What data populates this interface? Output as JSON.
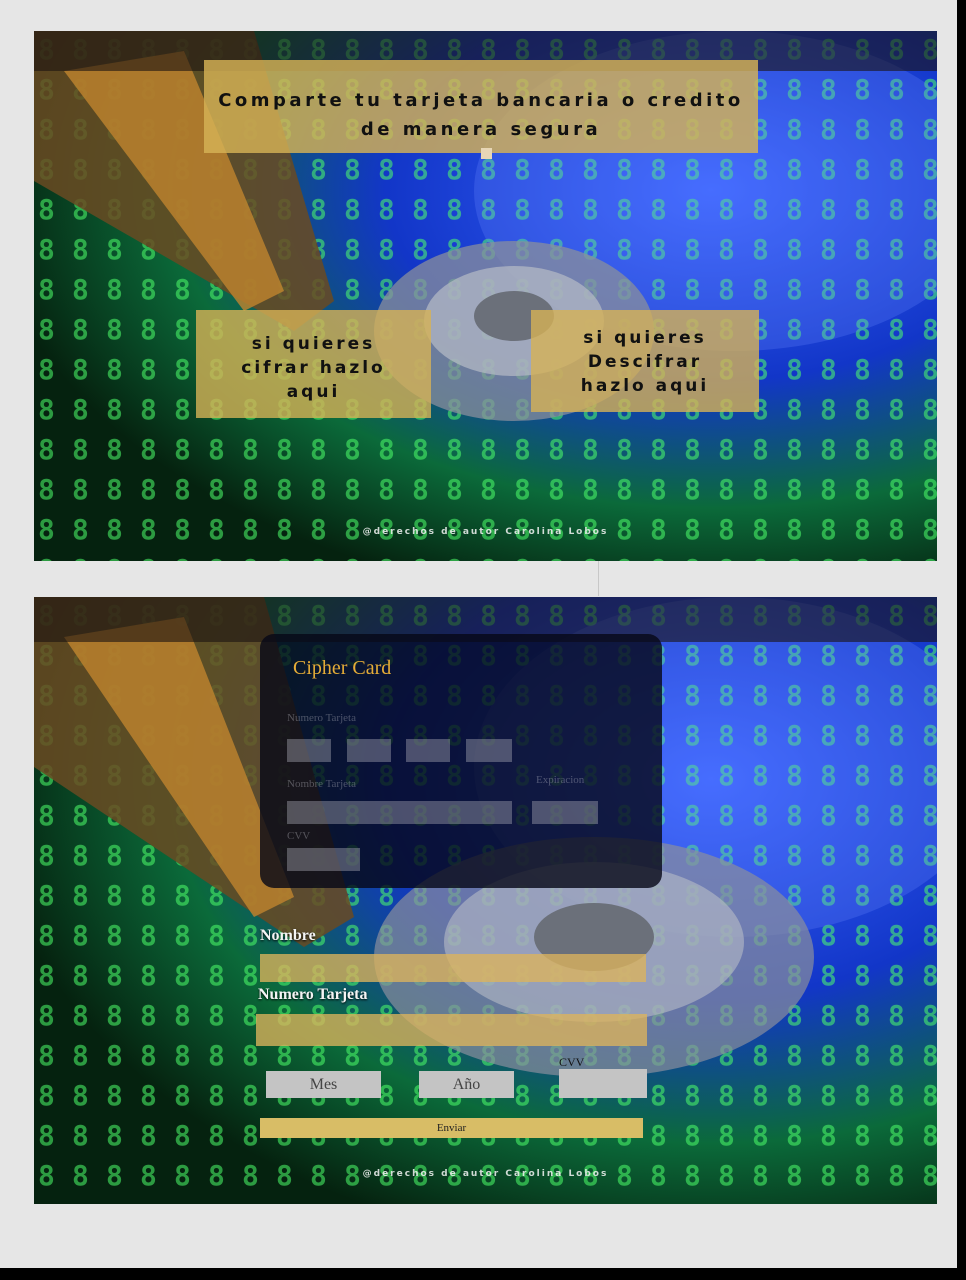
{
  "top_panel": {
    "headline": "Comparte tu tarjeta bancaria o credito de manera segura",
    "encrypt_label": "si quieres cifrar hazlo aqui",
    "decrypt_label": "si quieres Descifrar hazlo aqui",
    "credit": "@derechos de autor Carolina Lobos"
  },
  "card": {
    "title": "Cipher Card",
    "number_label": "Numero Tarjeta",
    "name_label": "Nombre Tarjeta",
    "expiration_label": "Expiracion",
    "cvv_label": "CVV"
  },
  "form": {
    "name_label": "Nombre",
    "number_label": "Numero Tarjeta",
    "month_option": "Mes",
    "year_option": "Año",
    "cvv_label": "CVV",
    "submit_label": "Enviar",
    "credit": "@derechos de autor Carolina Lobos"
  },
  "colors": {
    "accent_gold": "#d6b256",
    "card_title": "#e5ac37",
    "sheet": "#e6e6e6"
  }
}
